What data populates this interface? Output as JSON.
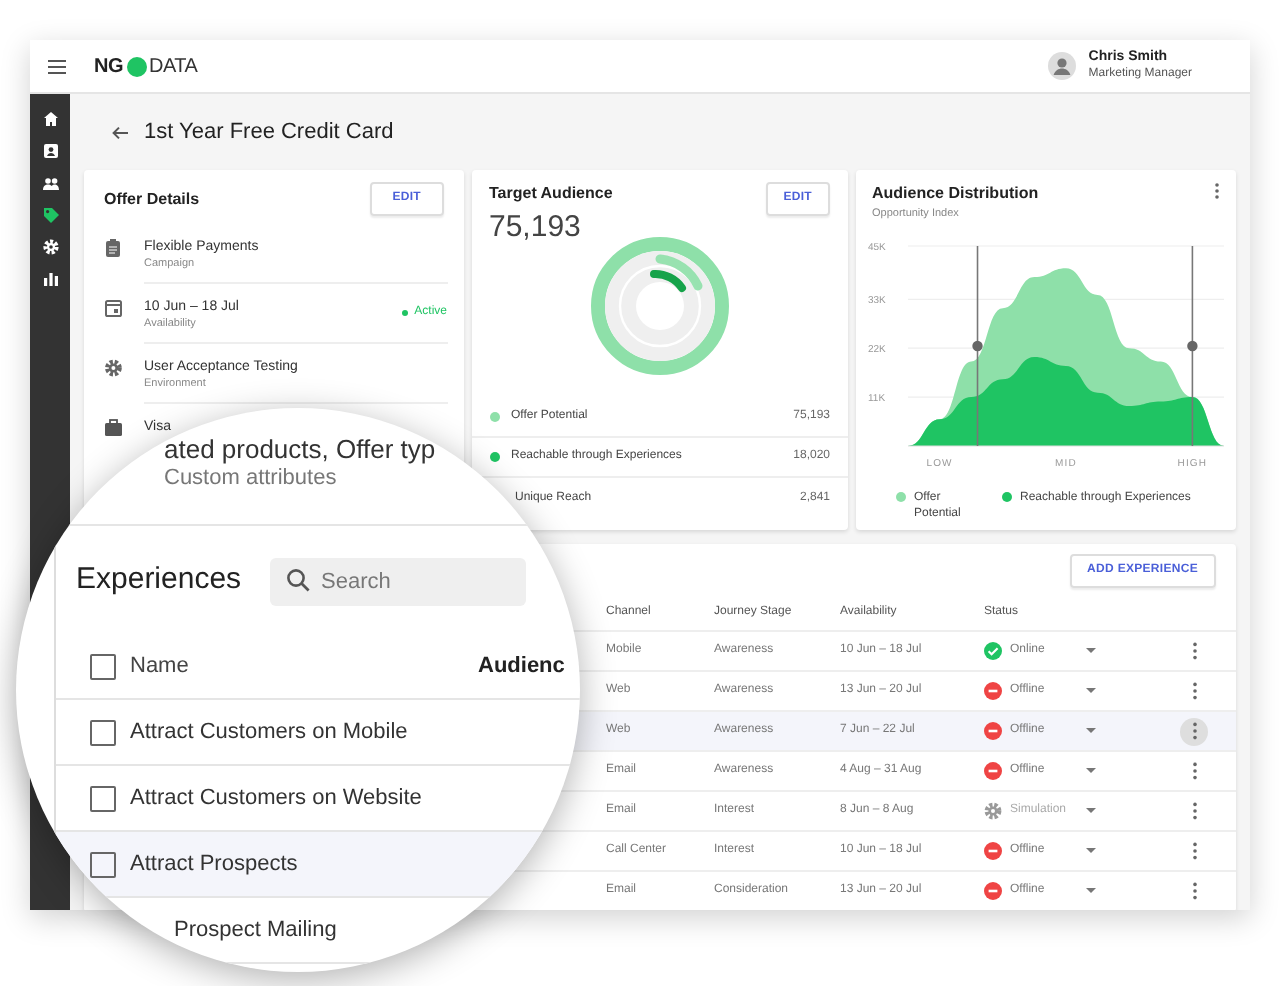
{
  "app_bar": {
    "logo": {
      "left": "NG",
      "right": "DATA"
    },
    "user": {
      "name": "Chris Smith",
      "role": "Marketing Manager"
    }
  },
  "sidebar": {
    "items": [
      {
        "kind": "home",
        "selected": false
      },
      {
        "kind": "contact",
        "selected": false
      },
      {
        "kind": "people",
        "selected": false
      },
      {
        "kind": "tag",
        "selected": true
      },
      {
        "kind": "gear",
        "selected": false
      },
      {
        "kind": "chart",
        "selected": false
      }
    ]
  },
  "page": {
    "title": "1st Year Free Credit Card"
  },
  "offer_details": {
    "title": "Offer Details",
    "edit_button": "EDIT",
    "items": [
      {
        "kind": "clipboard",
        "title": "Flexible Payments",
        "subtitle": "Campaign"
      },
      {
        "kind": "calendar",
        "title": "10 Jun – 18 Jul",
        "subtitle": "Availability",
        "badge": "Active"
      },
      {
        "kind": "gear",
        "title": "User Acceptance Testing",
        "subtitle": "Environment"
      },
      {
        "kind": "briefcase",
        "title": "Visa"
      }
    ]
  },
  "target_audience": {
    "title": "Target Audience",
    "edit_button": "EDIT",
    "total": "75,193",
    "legend": [
      {
        "label": "Offer Potential",
        "value": "75,193",
        "color": "#8ee0a9"
      },
      {
        "label": "Reachable through Experiences",
        "value": "18,020",
        "color": "#1fc463"
      },
      {
        "label": "Unique Reach",
        "value": "2,841"
      }
    ]
  },
  "audience_distribution": {
    "title": "Audience Distribution",
    "subtitle": "Opportunity Index",
    "chart_data": {
      "type": "area",
      "grid": true,
      "categories": [
        null,
        "LOW",
        null,
        null,
        null,
        "MID",
        null,
        null,
        null,
        "HIGH",
        null
      ],
      "ylim": [
        0,
        45000
      ],
      "yticks": [
        {
          "value": 11000,
          "label": "11K"
        },
        {
          "value": 22000,
          "label": "22K"
        },
        {
          "value": 33000,
          "label": "33K"
        },
        {
          "value": 45000,
          "label": "45K"
        }
      ],
      "series": [
        {
          "name": "Offer Potential",
          "color": "#8ee0a9",
          "values": [
            0,
            6000,
            19000,
            31000,
            38000,
            40000,
            34000,
            22000,
            19000,
            11000,
            0
          ]
        },
        {
          "name": "Reachable through Experiences",
          "color": "#1fc463",
          "values": [
            0,
            6000,
            11000,
            15000,
            20000,
            18000,
            12000,
            9000,
            10000,
            11000,
            0
          ]
        }
      ]
    }
  },
  "magnifier": {
    "attribute": {
      "title": "ated products, Offer typ",
      "subtitle": "Custom attributes"
    }
  },
  "experiences": {
    "title": "Experiences",
    "search": {
      "placeholder": "Search"
    },
    "add_button": "ADD EXPERIENCE",
    "header_checked": false,
    "columns": [
      "Name",
      "Audienc",
      "Channel",
      "Journey Stage",
      "Availability",
      "Status"
    ],
    "rows": [
      {
        "name": "Attract Customers on Mobile",
        "checked": false,
        "channel": "Mobile",
        "stage": "Awareness",
        "availability": "10 Jun – 18 Jul",
        "status": {
          "kind": "online",
          "label": "Online"
        },
        "selected": false
      },
      {
        "name": "Attract Customers on Website",
        "checked": false,
        "channel": "Web",
        "stage": "Awareness",
        "availability": "13 Jun – 20 Jul",
        "status": {
          "kind": "offline",
          "label": "Offline"
        },
        "selected": false
      },
      {
        "name": "Attract Prospects",
        "checked": false,
        "channel": "Web",
        "stage": "Awareness",
        "availability": "7 Jun – 22 Jul",
        "status": {
          "kind": "offline",
          "label": "Offline"
        },
        "selected": true
      },
      {
        "name": "Prospect Mailing",
        "channel": "Email",
        "stage": "Awareness",
        "availability": "4 Aug – 31 Aug",
        "status": {
          "kind": "offline",
          "label": "Offline"
        },
        "selected": false
      },
      {
        "channel": "Email",
        "stage": "Interest",
        "availability": "8 Jun – 8 Aug",
        "status": {
          "kind": "simulation",
          "label": "Simulation"
        },
        "selected": false
      },
      {
        "channel": "Call Center",
        "stage": "Interest",
        "availability": "10 Jun – 18 Jul",
        "status": {
          "kind": "offline",
          "label": "Offline"
        },
        "selected": false
      },
      {
        "channel": "Email",
        "stage": "Consideration",
        "availability": "13 Jun – 20 Jul",
        "status": {
          "kind": "offline",
          "label": "Offline"
        },
        "selected": false
      }
    ]
  }
}
